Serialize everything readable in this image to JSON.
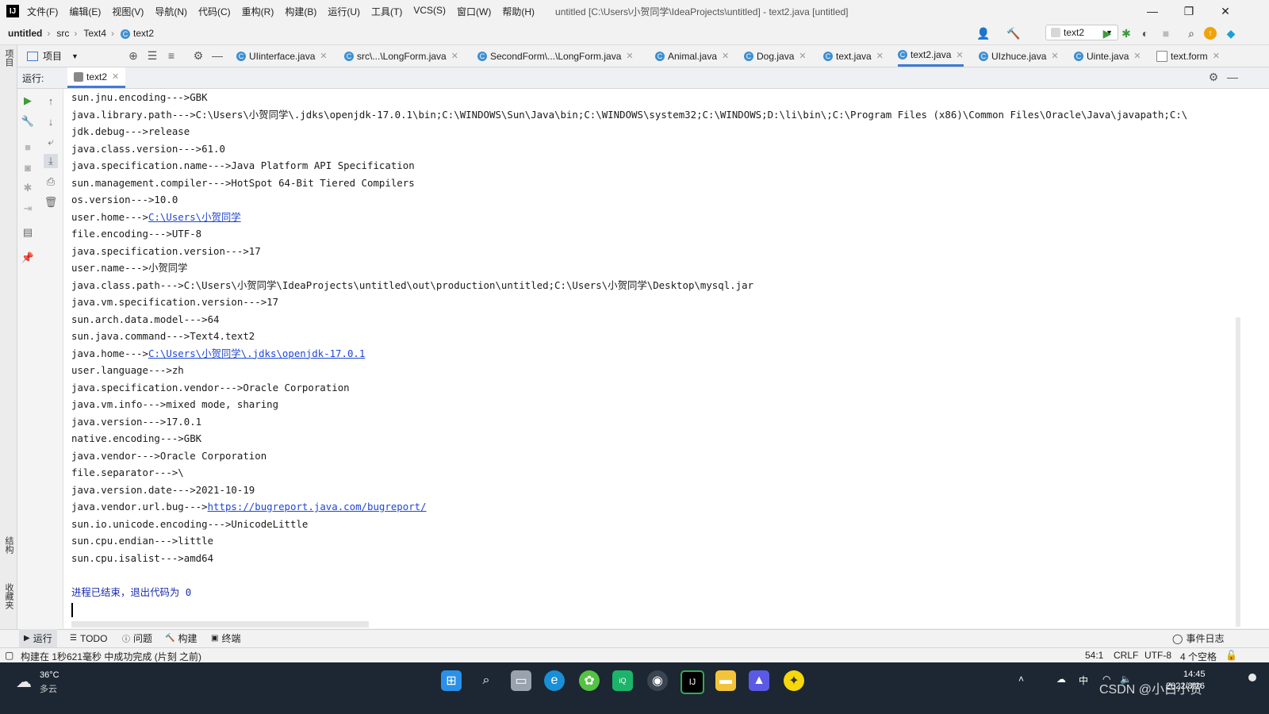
{
  "menubar": {
    "logo": "IJ",
    "items": [
      "文件(F)",
      "编辑(E)",
      "视图(V)",
      "导航(N)",
      "代码(C)",
      "重构(R)",
      "构建(B)",
      "运行(U)",
      "工具(T)",
      "VCS(S)",
      "窗口(W)",
      "帮助(H)"
    ],
    "window_title": "untitled [C:\\Users\\小贺同学\\IdeaProjects\\untitled] - text2.java [untitled]",
    "minimize": "—",
    "restore": "❐",
    "close": "✕"
  },
  "navbar": {
    "project": "untitled",
    "src": "src",
    "package": "Text4",
    "class": "text2",
    "run_config": "text2"
  },
  "project_panel": {
    "label": "项目"
  },
  "tabs": [
    {
      "label": "UIinterface.java"
    },
    {
      "label": "src\\...\\LongForm.java"
    },
    {
      "label": "SecondForm\\...\\LongForm.java"
    },
    {
      "label": "Animal.java"
    },
    {
      "label": "Dog.java"
    },
    {
      "label": "text.java"
    },
    {
      "label": "text2.java"
    },
    {
      "label": "UIzhuce.java"
    },
    {
      "label": "Uinte.java"
    },
    {
      "label": "text.form"
    }
  ],
  "run_panel": {
    "label": "运行:",
    "tab": "text2"
  },
  "console": {
    "lines": [
      {
        "text": "sun.jnu.encoding--->GBK"
      },
      {
        "text": "java.library.path--->C:\\Users\\小贺同学\\.jdks\\openjdk-17.0.1\\bin;C:\\WINDOWS\\Sun\\Java\\bin;C:\\WINDOWS\\system32;C:\\WINDOWS;D:\\li\\bin\\;C:\\Program Files (x86)\\Common Files\\Oracle\\Java\\javapath;C:\\"
      },
      {
        "text": "jdk.debug--->release"
      },
      {
        "text": "java.class.version--->61.0"
      },
      {
        "text": "java.specification.name--->Java Platform API Specification"
      },
      {
        "text": "sun.management.compiler--->HotSpot 64-Bit Tiered Compilers"
      },
      {
        "text": "os.version--->10.0"
      },
      {
        "text": "user.home--->",
        "link": "C:\\Users\\小贺同学"
      },
      {
        "text": "file.encoding--->UTF-8"
      },
      {
        "text": "java.specification.version--->17"
      },
      {
        "text": "user.name--->小贺同学"
      },
      {
        "text": "java.class.path--->C:\\Users\\小贺同学\\IdeaProjects\\untitled\\out\\production\\untitled;C:\\Users\\小贺同学\\Desktop\\mysql.jar"
      },
      {
        "text": "java.vm.specification.version--->17"
      },
      {
        "text": "sun.arch.data.model--->64"
      },
      {
        "text": "sun.java.command--->Text4.text2"
      },
      {
        "text": "java.home--->",
        "link": "C:\\Users\\小贺同学\\.jdks\\openjdk-17.0.1"
      },
      {
        "text": "user.language--->zh"
      },
      {
        "text": "java.specification.vendor--->Oracle Corporation"
      },
      {
        "text": "java.vm.info--->mixed mode, sharing"
      },
      {
        "text": "java.version--->17.0.1"
      },
      {
        "text": "native.encoding--->GBK"
      },
      {
        "text": "java.vendor--->Oracle Corporation"
      },
      {
        "text": "file.separator--->\\"
      },
      {
        "text": "java.version.date--->2021-10-19"
      },
      {
        "text": "java.vendor.url.bug--->",
        "link": "https://bugreport.java.com/bugreport/"
      },
      {
        "text": "sun.io.unicode.encoding--->UnicodeLittle"
      },
      {
        "text": "sun.cpu.endian--->little"
      },
      {
        "text": "sun.cpu.isalist--->amd64"
      }
    ],
    "exit_message": "进程已结束，退出代码为 0"
  },
  "bottom_tabs": [
    {
      "label": "运行",
      "icon": "play-icon"
    },
    {
      "label": "TODO",
      "icon": "list-icon"
    },
    {
      "label": "问题",
      "icon": "info-icon"
    },
    {
      "label": "构建",
      "icon": "hammer-icon"
    },
    {
      "label": "终端",
      "icon": "terminal-icon"
    }
  ],
  "event_log": "事件日志",
  "side_labels": {
    "structure": "结构",
    "favorites": "收藏夹"
  },
  "status": {
    "message": "构建在 1秒621毫秒 中成功完成 (片刻 之前)",
    "position": "54:1",
    "line_sep": "CRLF",
    "encoding": "UTF-8",
    "indent": "4 个空格"
  },
  "taskbar": {
    "weather_temp": "36°C",
    "weather_desc": "多云",
    "ime": "中",
    "time": "14:45",
    "date": "2022/8/26",
    "watermark": "CSDN @小白小贺"
  },
  "colors": {
    "accent": "#3d7bd6",
    "link": "#1f47d6",
    "taskbar": "#1c2733"
  }
}
